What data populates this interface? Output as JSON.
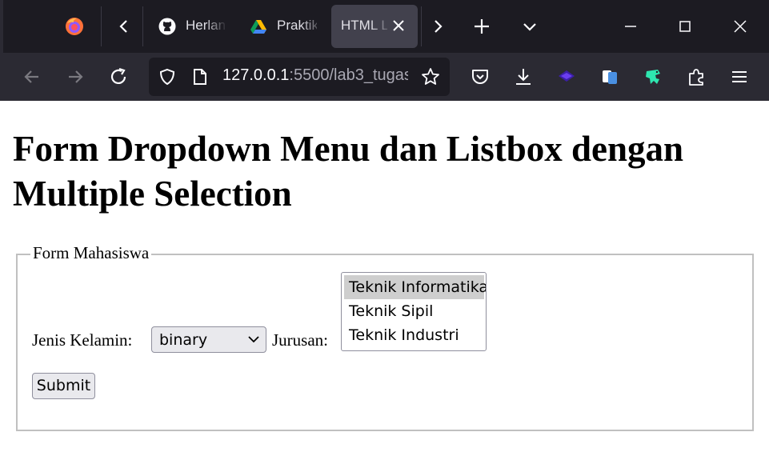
{
  "browser": {
    "tabs": [
      {
        "title": "Herlan",
        "icon": "github-icon"
      },
      {
        "title": "Praktik",
        "icon": "google-drive-icon"
      },
      {
        "title": "HTML L",
        "icon": "",
        "active": true
      }
    ],
    "url": {
      "host": "127.0.0.1",
      "rest": ":5500/lab3_tugas"
    },
    "colors": {
      "tabstrip": "#1c1b22",
      "navbar": "#2b2a33",
      "active_tab": "#42414d"
    }
  },
  "page": {
    "heading": "Form Dropdown Menu dan Listbox dengan Multiple Selection",
    "form": {
      "legend": "Form Mahasiswa",
      "gender_label": "Jenis Kelamin:",
      "gender_value": "binary",
      "major_label": "Jurusan:",
      "majors": [
        {
          "label": "Teknik Informatika",
          "selected": true
        },
        {
          "label": "Teknik Sipil",
          "selected": false
        },
        {
          "label": "Teknik Industri",
          "selected": false
        }
      ],
      "submit_label": "Submit"
    }
  }
}
